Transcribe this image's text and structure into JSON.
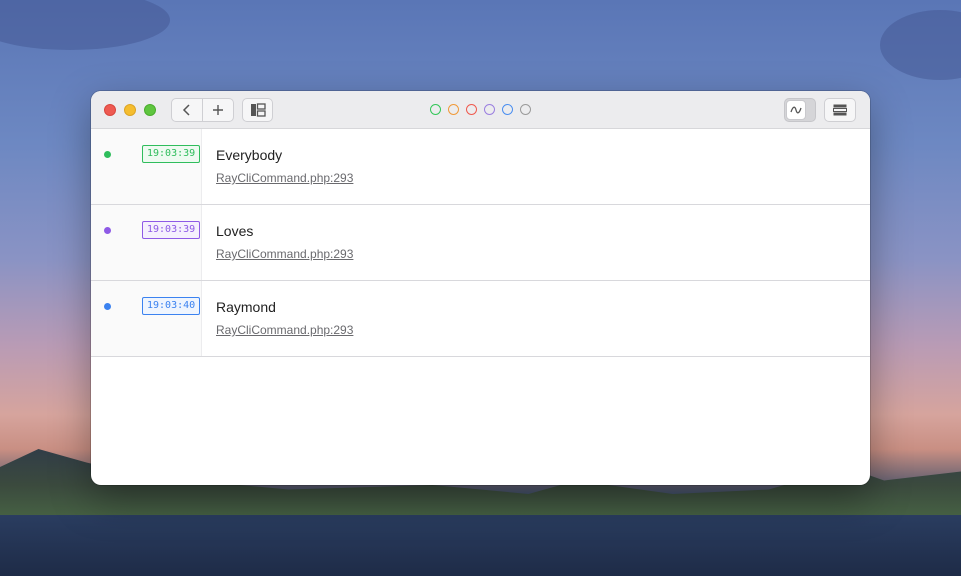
{
  "window": {
    "title_bar": {
      "color_filters": [
        {
          "name": "green",
          "color": "#34c759"
        },
        {
          "name": "orange",
          "color": "#f09a3a"
        },
        {
          "name": "red",
          "color": "#ef5a4f"
        },
        {
          "name": "purple",
          "color": "#9b7fe0"
        },
        {
          "name": "blue",
          "color": "#4a8ef0"
        },
        {
          "name": "gray",
          "color": "#9a9a9a"
        }
      ]
    },
    "entries": [
      {
        "time": "19:03:39",
        "color": "#2fbd5c",
        "badge_bg": "#eefaf1",
        "message": "Everybody",
        "origin": "RayCliCommand.php:293"
      },
      {
        "time": "19:03:39",
        "color": "#8e5ae6",
        "badge_bg": "#f5f0fd",
        "message": "Loves",
        "origin": "RayCliCommand.php:293"
      },
      {
        "time": "19:03:40",
        "color": "#3b82f0",
        "badge_bg": "#eff5fe",
        "message": "Raymond",
        "origin": "RayCliCommand.php:293"
      }
    ]
  }
}
